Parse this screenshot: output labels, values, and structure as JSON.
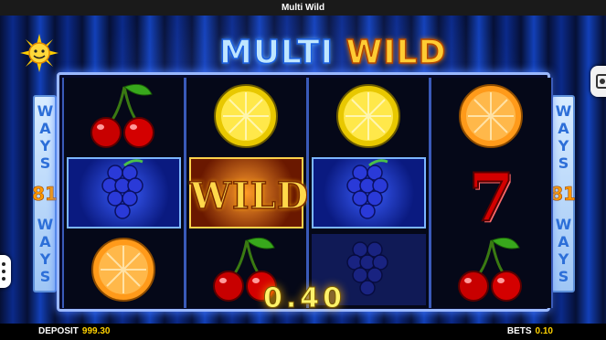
{
  "window": {
    "title": "Multi Wild"
  },
  "game": {
    "title_part1": "MULTI",
    "title_part2": "WILD",
    "ways_label": "WAYS",
    "ways_count": "81",
    "win_amount": "0.40"
  },
  "reels": [
    [
      "cherries",
      "grapes",
      "orange"
    ],
    [
      "lemon",
      "wild",
      "cherries"
    ],
    [
      "lemon",
      "grapes",
      "grapes"
    ],
    [
      "orange",
      "seven",
      "cherries"
    ]
  ],
  "symbols": {
    "wild_label": "WILD",
    "seven_label": "7"
  },
  "footer": {
    "deposit_label": "DEPOSIT",
    "deposit_value": "999.30",
    "bets_label": "BETS",
    "bets_value": "0.10"
  },
  "colors": {
    "accent_gold": "#ffd200",
    "frame_blue": "#9ab8ff"
  }
}
